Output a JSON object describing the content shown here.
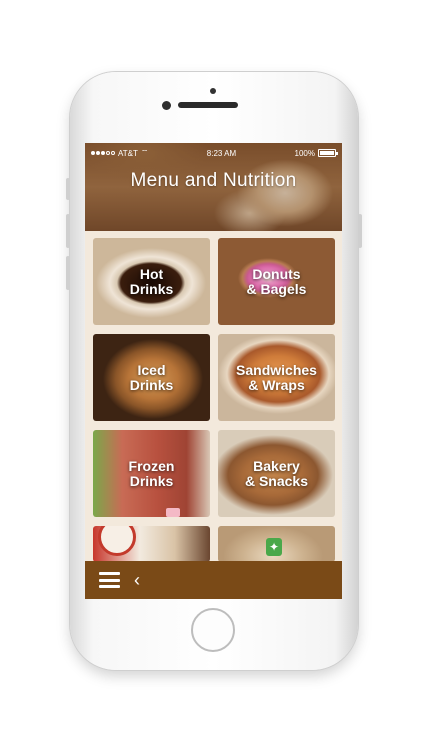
{
  "status_bar": {
    "carrier": "AT&T",
    "time": "8:23 AM",
    "battery": "100%"
  },
  "header": {
    "title": "Menu and Nutrition"
  },
  "menu": {
    "tiles": [
      {
        "label": "Hot\nDrinks"
      },
      {
        "label": "Donuts\n& Bagels"
      },
      {
        "label": "Iced\nDrinks"
      },
      {
        "label": "Sandwiches\n& Wraps"
      },
      {
        "label": "Frozen\nDrinks"
      },
      {
        "label": "Bakery\n& Snacks"
      },
      {
        "label": ""
      },
      {
        "label": ""
      }
    ]
  },
  "bottom_bar": {
    "menu_icon": "hamburger-icon",
    "back_icon": "chevron-left-icon",
    "back_glyph": "‹"
  },
  "colors": {
    "bottom_bar": "#7a4a17",
    "grid_background": "#f3e9dc"
  }
}
